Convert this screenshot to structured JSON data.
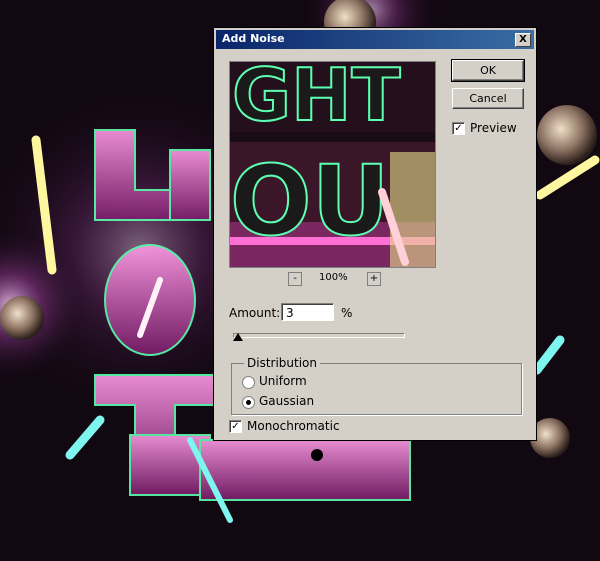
{
  "dialog": {
    "title": "Add Noise",
    "ok_label": "OK",
    "cancel_label": "Cancel",
    "preview_label": "Preview",
    "preview_checked": true,
    "zoom_out": "-",
    "zoom_level": "100%",
    "zoom_in": "+",
    "amount_label": "Amount:",
    "amount_value": "3",
    "amount_unit": "%",
    "amount_slider_fraction": 0.03,
    "distribution": {
      "title": "Distribution",
      "options": [
        "Uniform",
        "Gaussian"
      ],
      "selected": "Gaussian"
    },
    "monochromatic_label": "Monochromatic",
    "monochromatic_checked": true,
    "close_symbol": "X"
  },
  "colors": {
    "titlebar_start": "#0a246a",
    "titlebar_end": "#3a6ea5",
    "dialog_bg": "#d4d0c8",
    "neon_green": "#5dffb0",
    "neon_pink": "#ff66d9"
  }
}
